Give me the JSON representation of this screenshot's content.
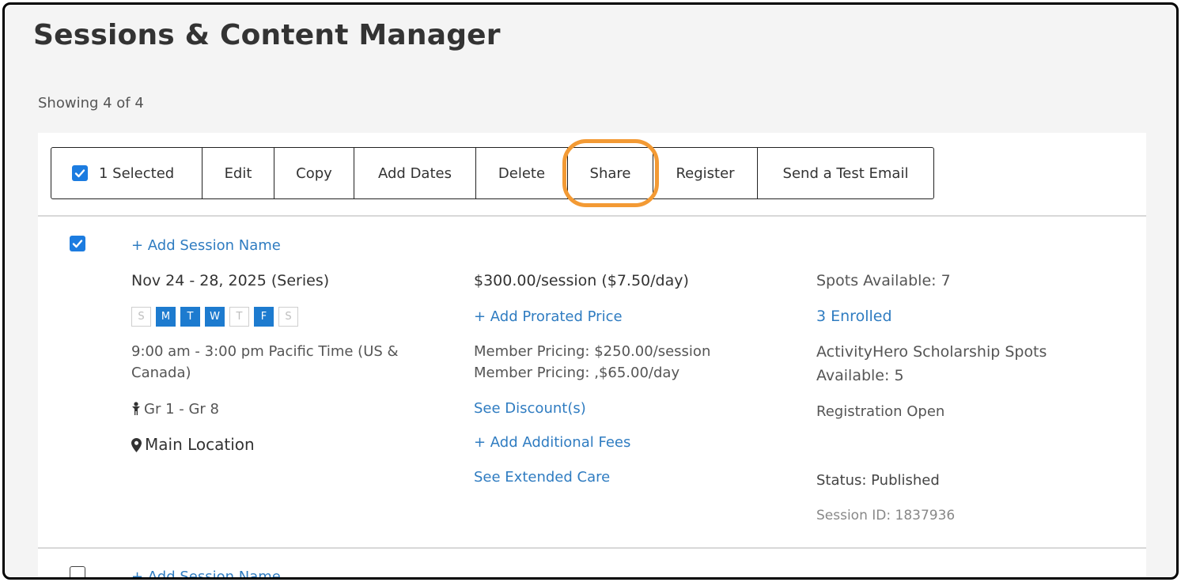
{
  "page": {
    "title": "Sessions & Content Manager",
    "showing": "Showing 4 of 4"
  },
  "toolbar": {
    "selected_label": "1 Selected",
    "edit": "Edit",
    "copy": "Copy",
    "add_dates": "Add Dates",
    "delete": "Delete",
    "share": "Share",
    "register": "Register",
    "send_test_email": "Send a Test Email"
  },
  "colors": {
    "accent": "#1c7ce0",
    "link": "#2f7cc1",
    "highlight": "#f39a34"
  },
  "sessions": [
    {
      "checked": true,
      "add_name": "+ Add Session Name",
      "dates": "Nov 24 - 28, 2025 (Series)",
      "days": [
        {
          "label": "S",
          "on": false
        },
        {
          "label": "M",
          "on": true
        },
        {
          "label": "T",
          "on": true
        },
        {
          "label": "W",
          "on": true
        },
        {
          "label": "T",
          "on": false
        },
        {
          "label": "F",
          "on": true
        },
        {
          "label": "S",
          "on": false
        }
      ],
      "time_line1": "9:00 am - 3:00 pm Pacific Time (US &",
      "time_line2": "Canada)",
      "grades": "Gr 1 - Gr 8",
      "location": "Main Location",
      "price": "$300.00/session ($7.50/day)",
      "add_prorated": "+ Add Prorated Price",
      "member_price_1": "Member Pricing: $250.00/session",
      "member_price_2": "Member Pricing: ,$65.00/day",
      "see_discounts": "See Discount(s)",
      "add_fees": "+ Add Additional Fees",
      "extended_care": "See Extended Care",
      "spots": "Spots Available: 7",
      "enrolled": "3 Enrolled",
      "scholarship_line1": "ActivityHero Scholarship Spots",
      "scholarship_line2": "Available: 5",
      "registration": "Registration Open",
      "status": "Status: Published",
      "session_id": "Session ID: 1837936"
    },
    {
      "checked": false,
      "add_name": "+ Add Session Name"
    }
  ]
}
